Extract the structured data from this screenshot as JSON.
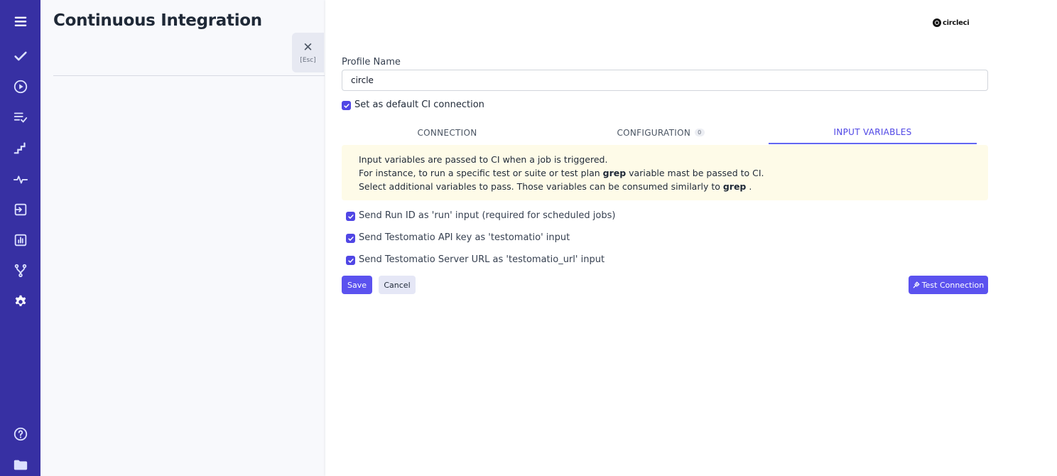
{
  "page": {
    "title": "Continuous Integration"
  },
  "close": {
    "icon": "close-icon",
    "symbol": "✕",
    "label": "[Esc]"
  },
  "sidebar": {
    "items": [
      {
        "name": "menu-icon"
      },
      {
        "name": "check-icon"
      },
      {
        "name": "play-circle-icon"
      },
      {
        "name": "list-check-icon"
      },
      {
        "name": "steps-icon"
      },
      {
        "name": "pulse-icon"
      },
      {
        "name": "import-icon"
      },
      {
        "name": "chart-icon"
      },
      {
        "name": "branch-icon"
      },
      {
        "name": "gear-icon"
      },
      {
        "name": "help-icon"
      },
      {
        "name": "folder-icon"
      }
    ]
  },
  "panel": {
    "logo_text": "circleci",
    "profile_label": "Profile Name",
    "profile_value": "circle",
    "default_label": "Set as default CI connection",
    "tabs": [
      {
        "label": "CONNECTION"
      },
      {
        "label": "CONFIGURATION",
        "badge": "0"
      },
      {
        "label": "INPUT VARIABLES",
        "active": true
      }
    ],
    "info": {
      "line1": "Input variables are passed to CI when a job is triggered.",
      "line2_pre": "For instance, to run a specific test or suite or test plan ",
      "line2_bold": "grep",
      "line2_post": " variable mast be passed to CI.",
      "line3_pre": "Select additional variables to pass. Those variables can be consumed similarly to ",
      "line3_bold": "grep",
      "line3_post": " ."
    },
    "options": [
      {
        "label": "Send Run ID as 'run' input (required for scheduled jobs)"
      },
      {
        "label": "Send Testomatio API key as 'testomatio' input"
      },
      {
        "label": "Send Testomatio Server URL as 'testomatio_url' input"
      }
    ],
    "buttons": {
      "save": "Save",
      "cancel": "Cancel",
      "test": "Test Connection"
    }
  },
  "colors": {
    "sidebar": "#3730a3",
    "accent": "#5b52ef",
    "info_bg": "#fefbe8"
  }
}
